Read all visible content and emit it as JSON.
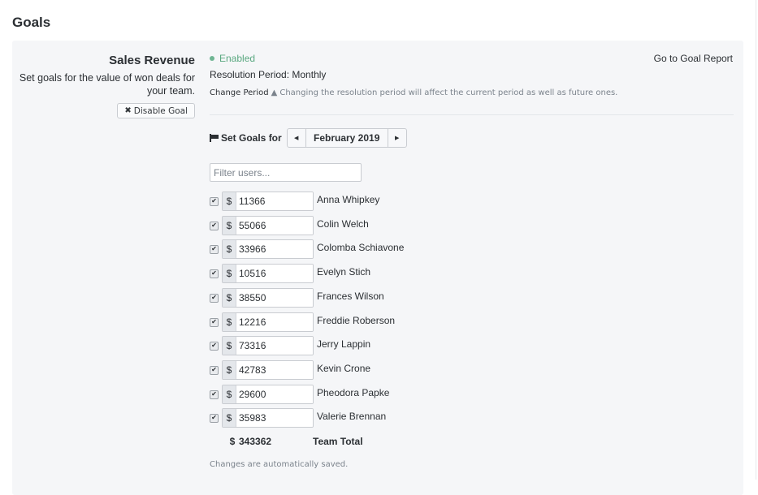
{
  "page": {
    "title": "Goals"
  },
  "goal": {
    "name": "Sales Revenue",
    "description": "Set goals for the value of won deals for your team.",
    "disable_label": "Disable Goal",
    "status": "Enabled",
    "status_color": "#5aa880",
    "resolution": "Resolution Period: Monthly",
    "change_period_label": "Change Period",
    "change_period_warning": "Changing the resolution period will affect the current period as well as future ones.",
    "report_link": "Go to Goal Report"
  },
  "period": {
    "label": "Set Goals for",
    "current": "February 2019",
    "prev_icon": "caret-left",
    "next_icon": "caret-right"
  },
  "filter": {
    "placeholder": "Filter users...",
    "value": ""
  },
  "currency_symbol": "$",
  "users": [
    {
      "name": "Anna Whipkey",
      "goal": "11366",
      "checked": true
    },
    {
      "name": "Colin Welch",
      "goal": "55066",
      "checked": true
    },
    {
      "name": "Colomba Schiavone",
      "goal": "33966",
      "checked": true
    },
    {
      "name": "Evelyn Stich",
      "goal": "10516",
      "checked": true
    },
    {
      "name": "Frances Wilson",
      "goal": "38550",
      "checked": true
    },
    {
      "name": "Freddie Roberson",
      "goal": "12216",
      "checked": true
    },
    {
      "name": "Jerry Lappin",
      "goal": "73316",
      "checked": true
    },
    {
      "name": "Kevin Crone",
      "goal": "42783",
      "checked": true
    },
    {
      "name": "Pheodora Papke",
      "goal": "29600",
      "checked": true
    },
    {
      "name": "Valerie Brennan",
      "goal": "35983",
      "checked": true
    }
  ],
  "total": {
    "label": "Team Total",
    "value": "343362"
  },
  "footer_note": "Changes are automatically saved."
}
